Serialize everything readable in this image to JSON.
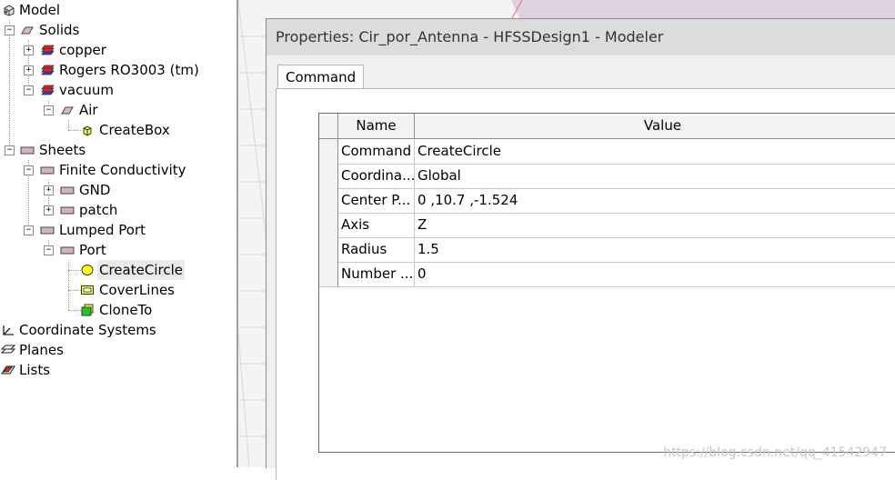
{
  "tree": {
    "root": "Model",
    "solids": {
      "label": "Solids",
      "items": [
        {
          "label": "copper"
        },
        {
          "label": "Rogers RO3003 (tm)"
        },
        {
          "label": "vacuum",
          "children": [
            {
              "label": "Air",
              "children": [
                {
                  "label": "CreateBox"
                }
              ]
            }
          ]
        }
      ]
    },
    "sheets": {
      "label": "Sheets",
      "items": [
        {
          "label": "Finite Conductivity",
          "children": [
            {
              "label": "GND"
            },
            {
              "label": "patch"
            }
          ]
        },
        {
          "label": "Lumped Port",
          "children": [
            {
              "label": "Port",
              "children": [
                {
                  "label": "CreateCircle"
                },
                {
                  "label": "CoverLines"
                },
                {
                  "label": "CloneTo"
                }
              ]
            }
          ]
        }
      ]
    },
    "coordinate_systems": "Coordinate Systems",
    "planes": "Planes",
    "lists": "Lists"
  },
  "dialog": {
    "title": "Properties: Cir_por_Antenna - HFSSDesign1 - Modeler",
    "tab": "Command",
    "columns": [
      "Name",
      "Value"
    ],
    "rows": [
      {
        "name": "Command",
        "value": "CreateCircle"
      },
      {
        "name": "Coordina...",
        "value": "Global"
      },
      {
        "name": "Center P...",
        "value": "0 ,10.7 ,-1.524"
      },
      {
        "name": "Axis",
        "value": "Z"
      },
      {
        "name": "Radius",
        "value": "1.5"
      },
      {
        "name": "Number ...",
        "value": "0"
      }
    ]
  },
  "watermark": "https://blog.csdn.net/qq_41542947",
  "colors": {
    "accent_selection": "#eaeaea",
    "red_solid": "#e8202a",
    "blue_solid": "#2c3fd8",
    "yellow_circle": "#ffff20",
    "green_clone": "#22c422"
  }
}
